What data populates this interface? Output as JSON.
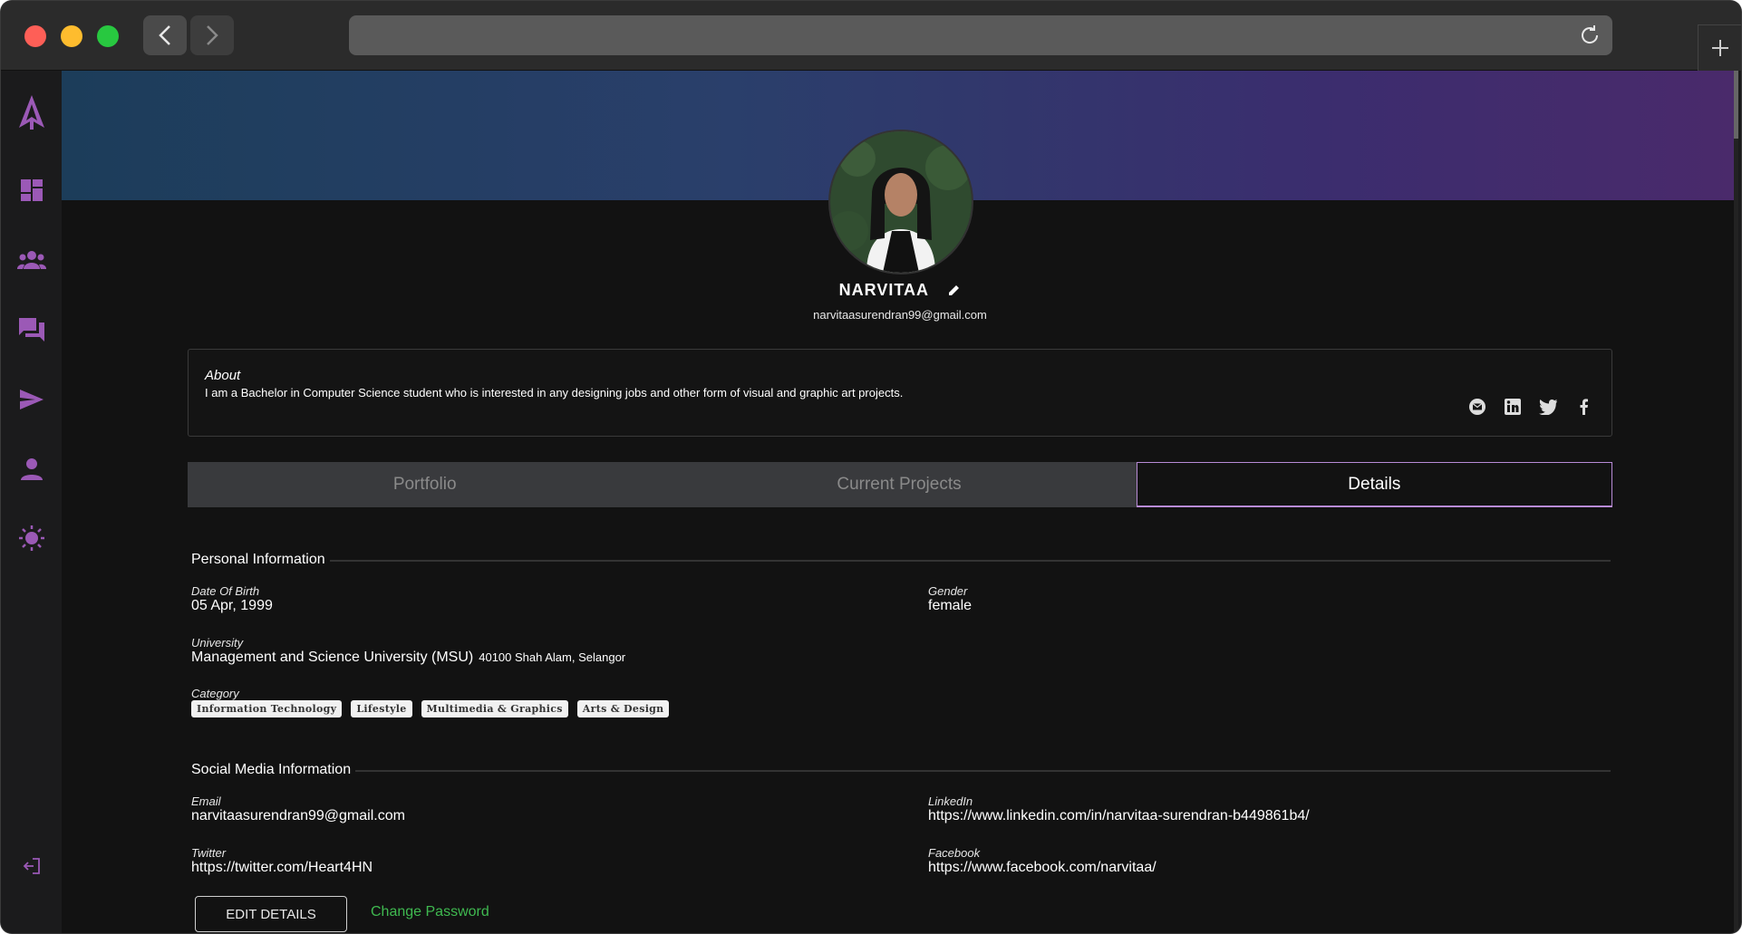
{
  "profile": {
    "name": "NARVITAA",
    "email": "narvitaasurendran99@gmail.com"
  },
  "about": {
    "title": "About",
    "text": "I am a Bachelor in Computer Science student who is interested in any designing jobs and other form of visual and graphic art projects."
  },
  "tabs": [
    {
      "label": "Portfolio"
    },
    {
      "label": "Current Projects"
    },
    {
      "label": "Details"
    }
  ],
  "personal": {
    "section_title": "Personal Information",
    "dob_label": "Date Of Birth",
    "dob_value": "05 Apr, 1999",
    "gender_label": "Gender",
    "gender_value": "female",
    "university_label": "University",
    "university_value": "Management and Science University (MSU)",
    "university_location": "40100 Shah Alam, Selangor",
    "category_label": "Category",
    "categories": [
      "Information Technology",
      "Lifestyle",
      "Multimedia & Graphics",
      "Arts & Design"
    ]
  },
  "social": {
    "section_title": "Social Media Information",
    "email_label": "Email",
    "email_value": "narvitaasurendran99@gmail.com",
    "linkedin_label": "LinkedIn",
    "linkedin_value": "https://www.linkedin.com/in/narvitaa-surendran-b449861b4/",
    "twitter_label": "Twitter",
    "twitter_value": "https://twitter.com/Heart4HN",
    "facebook_label": "Facebook",
    "facebook_value": "https://www.facebook.com/narvitaa/"
  },
  "actions": {
    "edit_label": "EDIT DETAILS",
    "change_password_label": "Change Password"
  },
  "colors": {
    "accent": "#9b59b6",
    "tab_border": "#b88bd6",
    "link_green": "#3fb950"
  }
}
